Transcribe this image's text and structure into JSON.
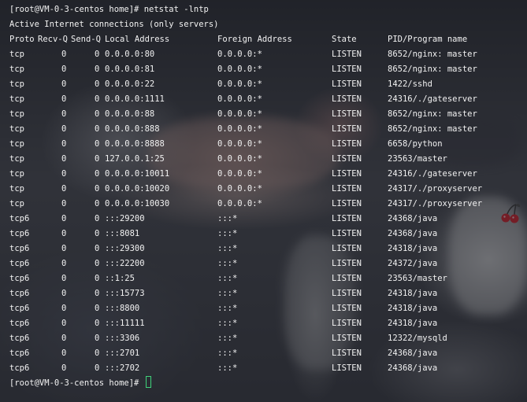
{
  "prompt": "[root@VM-0-3-centos home]# ",
  "command": "netstat -lntp",
  "summary": "Active Internet connections (only servers)",
  "headers": {
    "proto": "Proto",
    "recv_q": "Recv-Q",
    "send_q": "Send-Q",
    "local": "Local Address",
    "foreign": "Foreign Address",
    "state": "State",
    "pid": "PID/Program name"
  },
  "rows": [
    {
      "proto": "tcp",
      "recv": "0",
      "send": "0",
      "local": "0.0.0.0:80",
      "foreign": "0.0.0.0:*",
      "state": "LISTEN",
      "pid": "8652/nginx: master"
    },
    {
      "proto": "tcp",
      "recv": "0",
      "send": "0",
      "local": "0.0.0.0:81",
      "foreign": "0.0.0.0:*",
      "state": "LISTEN",
      "pid": "8652/nginx: master"
    },
    {
      "proto": "tcp",
      "recv": "0",
      "send": "0",
      "local": "0.0.0.0:22",
      "foreign": "0.0.0.0:*",
      "state": "LISTEN",
      "pid": "1422/sshd"
    },
    {
      "proto": "tcp",
      "recv": "0",
      "send": "0",
      "local": "0.0.0.0:1111",
      "foreign": "0.0.0.0:*",
      "state": "LISTEN",
      "pid": "24316/./gateserver"
    },
    {
      "proto": "tcp",
      "recv": "0",
      "send": "0",
      "local": "0.0.0.0:88",
      "foreign": "0.0.0.0:*",
      "state": "LISTEN",
      "pid": "8652/nginx: master"
    },
    {
      "proto": "tcp",
      "recv": "0",
      "send": "0",
      "local": "0.0.0.0:888",
      "foreign": "0.0.0.0:*",
      "state": "LISTEN",
      "pid": "8652/nginx: master"
    },
    {
      "proto": "tcp",
      "recv": "0",
      "send": "0",
      "local": "0.0.0.0:8888",
      "foreign": "0.0.0.0:*",
      "state": "LISTEN",
      "pid": "6658/python"
    },
    {
      "proto": "tcp",
      "recv": "0",
      "send": "0",
      "local": "127.0.0.1:25",
      "foreign": "0.0.0.0:*",
      "state": "LISTEN",
      "pid": "23563/master"
    },
    {
      "proto": "tcp",
      "recv": "0",
      "send": "0",
      "local": "0.0.0.0:10011",
      "foreign": "0.0.0.0:*",
      "state": "LISTEN",
      "pid": "24316/./gateserver"
    },
    {
      "proto": "tcp",
      "recv": "0",
      "send": "0",
      "local": "0.0.0.0:10020",
      "foreign": "0.0.0.0:*",
      "state": "LISTEN",
      "pid": "24317/./proxyserver"
    },
    {
      "proto": "tcp",
      "recv": "0",
      "send": "0",
      "local": "0.0.0.0:10030",
      "foreign": "0.0.0.0:*",
      "state": "LISTEN",
      "pid": "24317/./proxyserver"
    },
    {
      "proto": "tcp6",
      "recv": "0",
      "send": "0",
      "local": ":::29200",
      "foreign": ":::*",
      "state": "LISTEN",
      "pid": "24368/java"
    },
    {
      "proto": "tcp6",
      "recv": "0",
      "send": "0",
      "local": ":::8081",
      "foreign": ":::*",
      "state": "LISTEN",
      "pid": "24368/java"
    },
    {
      "proto": "tcp6",
      "recv": "0",
      "send": "0",
      "local": ":::29300",
      "foreign": ":::*",
      "state": "LISTEN",
      "pid": "24318/java"
    },
    {
      "proto": "tcp6",
      "recv": "0",
      "send": "0",
      "local": ":::22200",
      "foreign": ":::*",
      "state": "LISTEN",
      "pid": "24372/java"
    },
    {
      "proto": "tcp6",
      "recv": "0",
      "send": "0",
      "local": "::1:25",
      "foreign": ":::*",
      "state": "LISTEN",
      "pid": "23563/master"
    },
    {
      "proto": "tcp6",
      "recv": "0",
      "send": "0",
      "local": ":::15773",
      "foreign": ":::*",
      "state": "LISTEN",
      "pid": "24318/java"
    },
    {
      "proto": "tcp6",
      "recv": "0",
      "send": "0",
      "local": ":::8800",
      "foreign": ":::*",
      "state": "LISTEN",
      "pid": "24318/java"
    },
    {
      "proto": "tcp6",
      "recv": "0",
      "send": "0",
      "local": ":::11111",
      "foreign": ":::*",
      "state": "LISTEN",
      "pid": "24318/java"
    },
    {
      "proto": "tcp6",
      "recv": "0",
      "send": "0",
      "local": ":::3306",
      "foreign": ":::*",
      "state": "LISTEN",
      "pid": "12322/mysqld"
    },
    {
      "proto": "tcp6",
      "recv": "0",
      "send": "0",
      "local": ":::2701",
      "foreign": ":::*",
      "state": "LISTEN",
      "pid": "24368/java"
    },
    {
      "proto": "tcp6",
      "recv": "0",
      "send": "0",
      "local": ":::2702",
      "foreign": ":::*",
      "state": "LISTEN",
      "pid": "24368/java"
    }
  ],
  "colors": {
    "text": "#f2f2f2",
    "cursor": "#3fd27a",
    "cherry": "#d2222f"
  },
  "icons": {
    "cursor": "block-cursor",
    "wallpaper_decoration": "cherry-icon"
  }
}
